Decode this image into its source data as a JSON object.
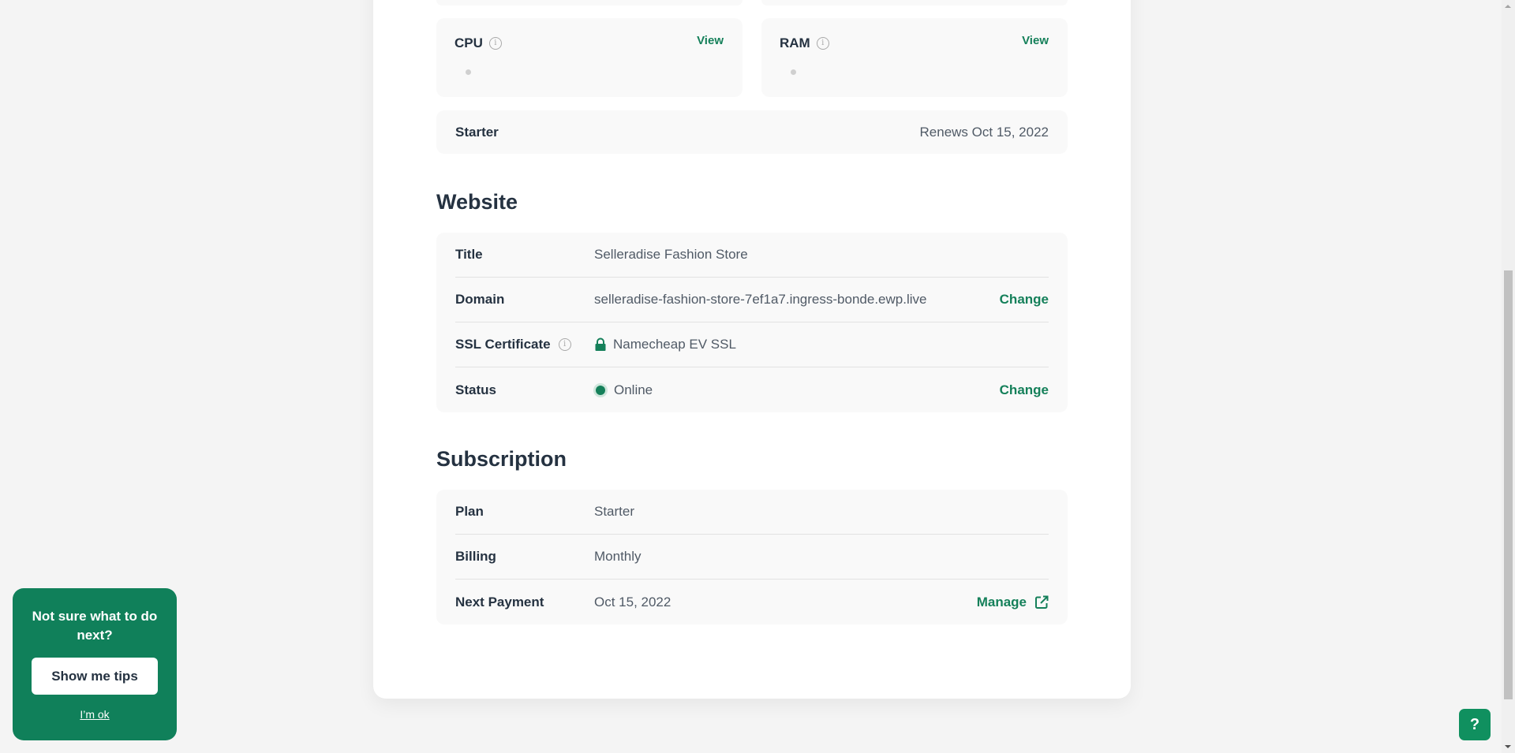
{
  "resources": {
    "cpu": {
      "title": "CPU",
      "view_label": "View"
    },
    "ram": {
      "title": "RAM",
      "view_label": "View"
    }
  },
  "plan_summary": {
    "name": "Starter",
    "renewal": "Renews Oct 15, 2022"
  },
  "website": {
    "heading": "Website",
    "rows": {
      "title": {
        "label": "Title",
        "value": "Selleradise Fashion Store"
      },
      "domain": {
        "label": "Domain",
        "value": "selleradise-fashion-store-7ef1a7.ingress-bonde.ewp.live",
        "action": "Change"
      },
      "ssl": {
        "label": "SSL Certificate",
        "value": "Namecheap EV SSL"
      },
      "status": {
        "label": "Status",
        "value": "Online",
        "action": "Change"
      }
    }
  },
  "subscription": {
    "heading": "Subscription",
    "rows": {
      "plan": {
        "label": "Plan",
        "value": "Starter"
      },
      "billing": {
        "label": "Billing",
        "value": "Monthly"
      },
      "next_payment": {
        "label": "Next Payment",
        "value": "Oct 15, 2022",
        "action": "Manage"
      }
    }
  },
  "tips": {
    "prompt": "Not sure what to do next?",
    "button": "Show me tips",
    "dismiss": "I’m ok"
  },
  "help": {
    "label": "?"
  },
  "colors": {
    "accent": "#15805a",
    "tips_background": "#10805a"
  }
}
